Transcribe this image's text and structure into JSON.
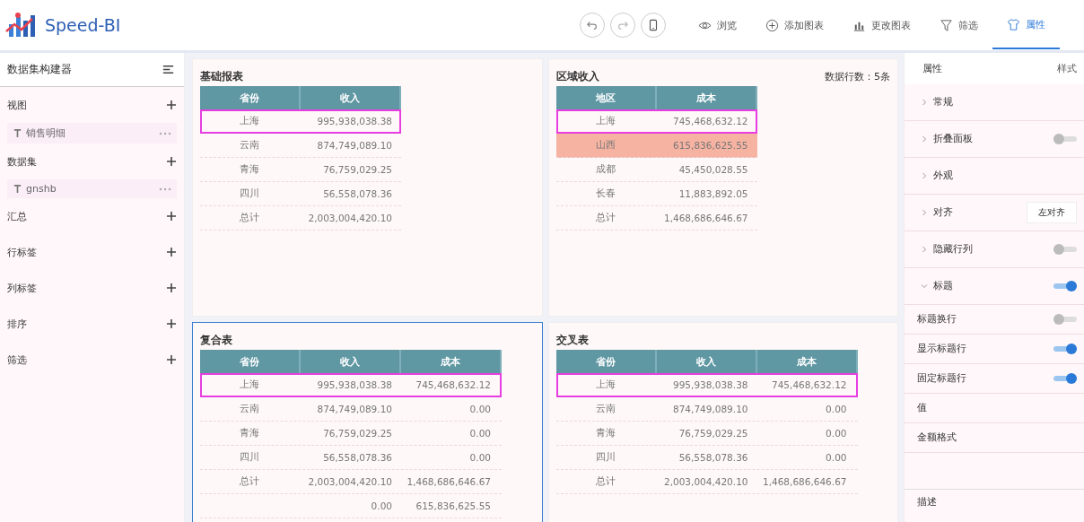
{
  "app": {
    "name": "Speed-BI"
  },
  "toolbar": [
    {
      "label": "浏览",
      "selected": false
    },
    {
      "label": "添加图表",
      "selected": false
    },
    {
      "label": "更改图表",
      "selected": false
    },
    {
      "label": "筛选",
      "selected": false
    },
    {
      "label": "属性",
      "selected": true
    }
  ],
  "builder": {
    "title": "数据集构建器",
    "sections": [
      {
        "label": "视图",
        "items": [
          "销售明细"
        ]
      },
      {
        "label": "数据集",
        "items": [
          "gnshb"
        ]
      },
      {
        "label": "汇总"
      },
      {
        "label": "行标签"
      },
      {
        "label": "列标签"
      },
      {
        "label": "排序"
      },
      {
        "label": "筛选"
      }
    ]
  },
  "charts": [
    {
      "title": "基础报表",
      "selected": false,
      "columns": [
        "省份",
        "收入"
      ],
      "rows": [
        {
          "cells": [
            "上海",
            "995,938,038.38"
          ],
          "highlighted": true,
          "selected": false
        },
        {
          "cells": [
            "云南",
            "874,749,089.10"
          ],
          "highlighted": false,
          "selected": false
        },
        {
          "cells": [
            "青海",
            "76,759,029.25"
          ],
          "highlighted": false,
          "selected": false
        },
        {
          "cells": [
            "四川",
            "56,558,078.36"
          ],
          "highlighted": false,
          "selected": false
        },
        {
          "cells": [
            "总计",
            "2,003,004,420.10"
          ],
          "highlighted": false,
          "selected": false
        }
      ]
    },
    {
      "title": "区域收入",
      "note": "数据行数：5条",
      "selected": false,
      "columns": [
        "地区",
        "成本"
      ],
      "rows": [
        {
          "cells": [
            "上海",
            "745,468,632.12"
          ],
          "highlighted": true,
          "selected": false
        },
        {
          "cells": [
            "山西",
            "615,836,625.55"
          ],
          "highlighted": false,
          "selected": true
        },
        {
          "cells": [
            "成都",
            "45,450,028.55"
          ],
          "highlighted": false,
          "selected": false
        },
        {
          "cells": [
            "长春",
            "11,883,892.05"
          ],
          "highlighted": false,
          "selected": false
        },
        {
          "cells": [
            "总计",
            "1,468,686,646.67"
          ],
          "highlighted": false,
          "selected": false
        }
      ]
    },
    {
      "title": "复合表",
      "selected": true,
      "columns": [
        "省份",
        "收入",
        "成本"
      ],
      "rows": [
        {
          "cells": [
            "上海",
            "995,938,038.38",
            "745,468,632.12"
          ],
          "highlighted": true,
          "selected": false
        },
        {
          "cells": [
            "云南",
            "874,749,089.10",
            "0.00"
          ],
          "highlighted": false,
          "selected": false
        },
        {
          "cells": [
            "青海",
            "76,759,029.25",
            "0.00"
          ],
          "highlighted": false,
          "selected": false
        },
        {
          "cells": [
            "四川",
            "56,558,078.36",
            "0.00"
          ],
          "highlighted": false,
          "selected": false
        },
        {
          "cells": [
            "总计",
            "2,003,004,420.10",
            "1,468,686,646.67"
          ],
          "highlighted": false,
          "selected": false
        },
        {
          "cells": [
            "",
            "0.00",
            "615,836,625.55"
          ],
          "highlighted": false,
          "selected": false
        }
      ]
    },
    {
      "title": "交叉表",
      "selected": false,
      "columns": [
        "省份",
        "收入",
        "成本"
      ],
      "rows": [
        {
          "cells": [
            "上海",
            "995,938,038.38",
            "745,468,632.12"
          ],
          "highlighted": true,
          "selected": false
        },
        {
          "cells": [
            "云南",
            "874,749,089.10",
            "0.00"
          ],
          "highlighted": false,
          "selected": false
        },
        {
          "cells": [
            "青海",
            "76,759,029.25",
            "0.00"
          ],
          "highlighted": false,
          "selected": false
        },
        {
          "cells": [
            "四川",
            "56,558,078.36",
            "0.00"
          ],
          "highlighted": false,
          "selected": false
        },
        {
          "cells": [
            "总计",
            "2,003,004,420.10",
            "1,468,686,646.67"
          ],
          "highlighted": false,
          "selected": false
        }
      ]
    }
  ],
  "properties": {
    "title": "属性",
    "tab": "样式",
    "rows": [
      {
        "kind": "section",
        "label": "常规",
        "expanded": false
      },
      {
        "kind": "section",
        "label": "折叠面板",
        "expanded": false,
        "on": false
      },
      {
        "kind": "section",
        "label": "外观",
        "expanded": false
      },
      {
        "kind": "section",
        "label": "对齐",
        "expanded": false,
        "value": "左对齐"
      },
      {
        "kind": "section",
        "label": "隐藏行列",
        "expanded": false,
        "on": false
      },
      {
        "kind": "section",
        "label": "标题",
        "expanded": true,
        "on": true
      },
      {
        "kind": "option",
        "label": "标题换行",
        "on": false
      },
      {
        "kind": "option",
        "label": "显示标题行",
        "on": true
      },
      {
        "kind": "option",
        "label": "固定标题行",
        "on": true
      },
      {
        "kind": "option",
        "label": "值"
      },
      {
        "kind": "option",
        "label": "金额格式"
      }
    ],
    "footer": "描述"
  }
}
